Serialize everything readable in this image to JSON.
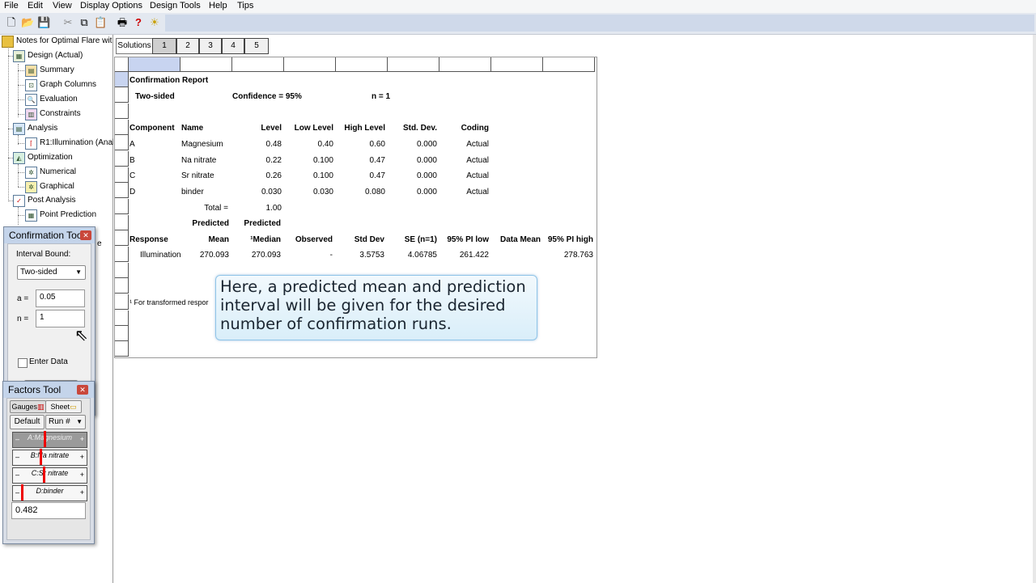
{
  "menu": [
    "File",
    "Edit",
    "View",
    "Display Options",
    "Design Tools",
    "Help",
    "Tips"
  ],
  "tree": {
    "root": "Notes for Optimal Flare wit",
    "design": "Design (Actual)",
    "summary": "Summary",
    "graph_columns": "Graph Columns",
    "evaluation": "Evaluation",
    "constraints": "Constraints",
    "analysis": "Analysis",
    "r1": "R1:Illumination (Anal",
    "optimization": "Optimization",
    "numerical": "Numerical",
    "graphical": "Graphical",
    "post_analysis": "Post Analysis",
    "point_prediction": "Point Prediction",
    "partial_e": "e"
  },
  "solutions": {
    "label": "Solutions",
    "tabs": [
      "1",
      "2",
      "3",
      "4",
      "5"
    ]
  },
  "report": {
    "title": "Confirmation Report",
    "sided": "Two-sided",
    "confidence": "Confidence = 95%",
    "n": "n =   1",
    "headers": {
      "component": "Component",
      "name": "Name",
      "level": "Level",
      "low": "Low Level",
      "high": "High Level",
      "std": "Std. Dev.",
      "coding": "Coding"
    },
    "rows": [
      {
        "component": "A",
        "name": "Magnesium",
        "level": "0.48",
        "low": "0.40",
        "high": "0.60",
        "std": "0.000",
        "coding": "Actual"
      },
      {
        "component": "B",
        "name": "Na nitrate",
        "level": "0.22",
        "low": "0.100",
        "high": "0.47",
        "std": "0.000",
        "coding": "Actual"
      },
      {
        "component": "C",
        "name": "Sr nitrate",
        "level": "0.26",
        "low": "0.100",
        "high": "0.47",
        "std": "0.000",
        "coding": "Actual"
      },
      {
        "component": "D",
        "name": "binder",
        "level": "0.030",
        "low": "0.030",
        "high": "0.080",
        "std": "0.000",
        "coding": "Actual"
      }
    ],
    "total_label": "Total =",
    "total_value": "1.00",
    "pred1": "Predicted",
    "pred2": "Predicted",
    "resp_headers": {
      "response": "Response",
      "mean": "Mean",
      "median": "¹Median",
      "observed": "Observed",
      "stddev": "Std Dev",
      "se": "SE (n=1)",
      "pilow": "95% PI low",
      "datamean": "Data Mean",
      "pihigh": "95% PI high"
    },
    "resp_row": {
      "response": "Illumination",
      "mean": "270.093",
      "median": "270.093",
      "observed": "-",
      "stddev": "3.5753",
      "se": "4.06785",
      "pilow": "261.422",
      "datamean": "",
      "pihigh": "278.763"
    },
    "footnote": "¹ For transformed respor"
  },
  "callout": {
    "line1": "Here, a predicted mean and prediction",
    "line2": "interval will be given for the desired",
    "line3": "number of confirmation runs."
  },
  "confirmation_tool": {
    "title": "Confirmation Tool",
    "interval_bound": "Interval Bound:",
    "select_value": "Two-sided",
    "alpha_label": "a =",
    "alpha_value": "0.05",
    "n_label": "n =",
    "n_value": "1",
    "enter_data": "Enter Data"
  },
  "factors_tool": {
    "title": "Factors Tool",
    "gauges": "Gauges",
    "sheet": "Sheet",
    "default": "Default",
    "run": "Run #",
    "gauge_a": "A:Magnesium",
    "gauge_b": "B:Na nitrate",
    "gauge_c": "C:Sr nitrate",
    "gauge_d": "D:binder",
    "value": "0.482"
  },
  "colors": {
    "accent": "#c4d4ea",
    "callout_border": "#8fc4e8",
    "marker": "#ee0000"
  }
}
